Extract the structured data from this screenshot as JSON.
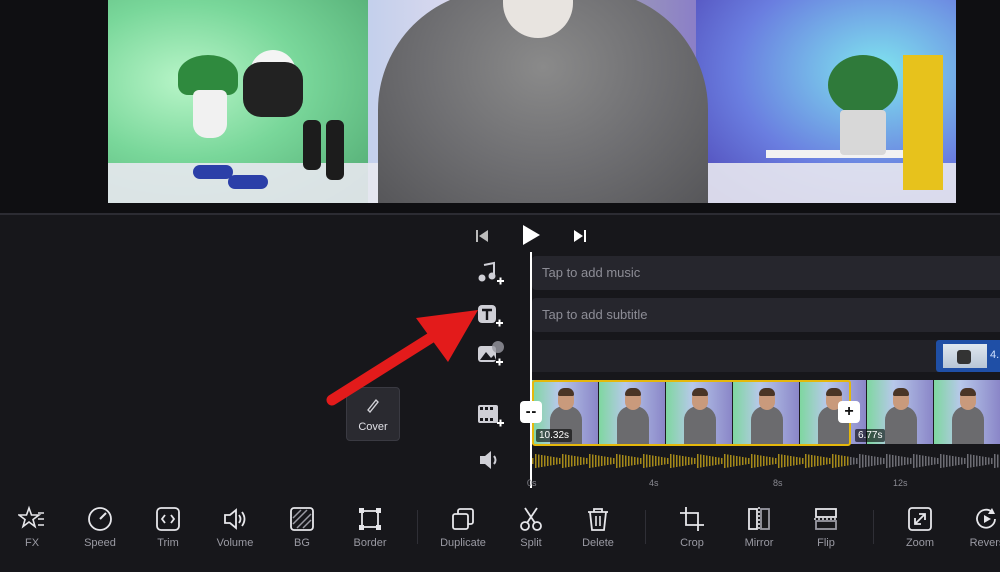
{
  "transport": {
    "prev": "skip-back",
    "play": "play",
    "next": "skip-forward"
  },
  "tracks": {
    "music_placeholder": "Tap to add music",
    "subtitle_placeholder": "Tap to add subtitle",
    "pip_clip_label": "4."
  },
  "clips": {
    "selected_duration": "10.32s",
    "next_duration": "6.77s"
  },
  "handles": {
    "left": "--",
    "right": "+"
  },
  "cover": {
    "label": "Cover"
  },
  "ruler": [
    "0s",
    "4s",
    "8s",
    "12s"
  ],
  "toolbar": {
    "items": [
      {
        "label": "FX",
        "icon": "fx-star-icon"
      },
      {
        "label": "Speed",
        "icon": "speed-gauge-icon"
      },
      {
        "label": "Trim",
        "icon": "trim-icon"
      },
      {
        "label": "Volume",
        "icon": "volume-icon"
      },
      {
        "label": "BG",
        "icon": "background-icon"
      },
      {
        "label": "Border",
        "icon": "border-icon"
      },
      {
        "label": "Duplicate",
        "icon": "duplicate-icon"
      },
      {
        "label": "Split",
        "icon": "scissors-icon"
      },
      {
        "label": "Delete",
        "icon": "trash-icon"
      },
      {
        "label": "Crop",
        "icon": "crop-icon"
      },
      {
        "label": "Mirror",
        "icon": "mirror-icon"
      },
      {
        "label": "Flip",
        "icon": "flip-icon"
      },
      {
        "label": "Zoom",
        "icon": "zoom-icon"
      },
      {
        "label": "Revers",
        "icon": "reverse-icon"
      }
    ]
  },
  "colors": {
    "selection": "#e5b80b",
    "arrow": "#e31b1b",
    "pip_clip": "#1f4fa6"
  }
}
